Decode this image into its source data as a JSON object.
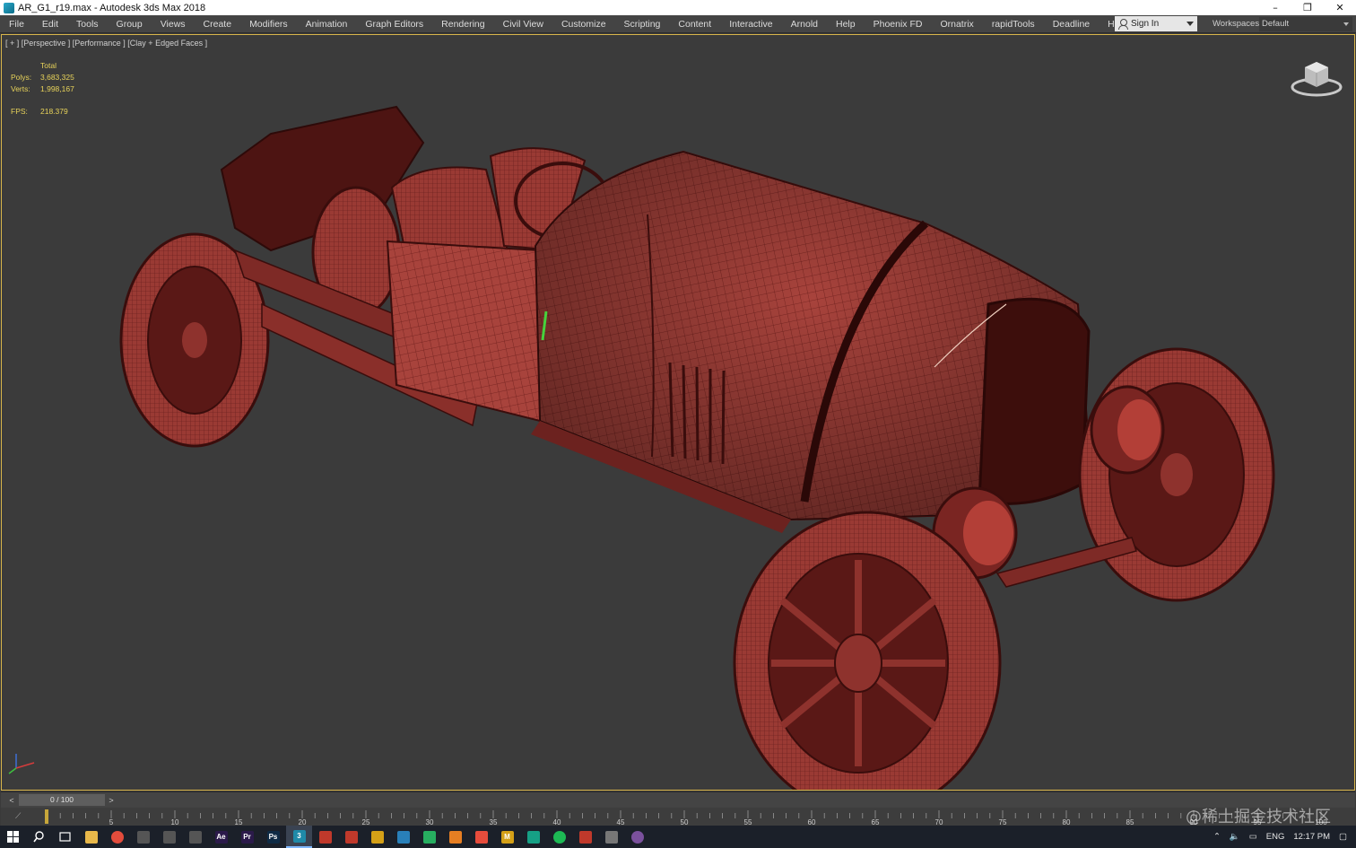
{
  "window": {
    "title": "AR_G1_r19.max - Autodesk 3ds Max 2018",
    "controls": [
      "–",
      "❐",
      "✕"
    ]
  },
  "menu": [
    "File",
    "Edit",
    "Tools",
    "Group",
    "Views",
    "Create",
    "Modifiers",
    "Animation",
    "Graph Editors",
    "Rendering",
    "Civil View",
    "Customize",
    "Scripting",
    "Content",
    "Interactive",
    "Arnold",
    "Help",
    "Phoenix FD",
    "Ornatrix",
    "rapidTools",
    "Deadline",
    "Houdini Engine"
  ],
  "signin": {
    "label": "Sign In"
  },
  "workspace": {
    "label": "Workspaces:",
    "value": "Default"
  },
  "viewport": {
    "label": "[ + ] [Perspective ] [Performance ] [Clay + Edged Faces ]",
    "stats": {
      "header": "Total",
      "polys_label": "Polys:",
      "polys": "3,683,325",
      "verts_label": "Verts:",
      "verts": "1,998,167",
      "fps_label": "FPS:",
      "fps": "218.379"
    },
    "model_color": "#a8433c",
    "bg_color": "#3b3b3b"
  },
  "timeline": {
    "prev": "<",
    "next": ">",
    "frame": "0 / 100",
    "ticks": [
      "5",
      "10",
      "15",
      "20",
      "25",
      "30",
      "35",
      "40",
      "45",
      "50",
      "55",
      "60",
      "65",
      "70",
      "75",
      "80",
      "85",
      "90",
      "95",
      "100"
    ]
  },
  "watermark": "@稀土掘金技术社区",
  "taskbar": {
    "apps": [
      {
        "name": "windows-start-icon",
        "color": "#ffffff",
        "glyph": ""
      },
      {
        "name": "search-icon",
        "color": "#ffffff",
        "glyph": ""
      },
      {
        "name": "task-view-icon",
        "color": "#ffffff",
        "glyph": ""
      },
      {
        "name": "file-explorer-icon",
        "color": "#e8b84a",
        "glyph": ""
      },
      {
        "name": "chrome-icon",
        "color": "#e34c3c",
        "glyph": ""
      },
      {
        "name": "app-icon-1",
        "color": "#555555",
        "glyph": ""
      },
      {
        "name": "app-icon-2",
        "color": "#555555",
        "glyph": ""
      },
      {
        "name": "app-icon-3",
        "color": "#555555",
        "glyph": ""
      },
      {
        "name": "after-effects-icon",
        "color": "#2b1a4a",
        "glyph": "Ae"
      },
      {
        "name": "premiere-icon",
        "color": "#2b1a4a",
        "glyph": "Pr"
      },
      {
        "name": "photoshop-icon",
        "color": "#0f2b45",
        "glyph": "Ps"
      },
      {
        "name": "3ds-max-icon",
        "color": "#1f8aa8",
        "glyph": "3"
      },
      {
        "name": "app-icon-4",
        "color": "#c0392b",
        "glyph": ""
      },
      {
        "name": "app-icon-5",
        "color": "#c0392b",
        "glyph": ""
      },
      {
        "name": "app-icon-6",
        "color": "#d4a017",
        "glyph": ""
      },
      {
        "name": "app-icon-7",
        "color": "#2980b9",
        "glyph": ""
      },
      {
        "name": "app-icon-8",
        "color": "#27ae60",
        "glyph": ""
      },
      {
        "name": "houdini-icon",
        "color": "#e67e22",
        "glyph": ""
      },
      {
        "name": "app-icon-9",
        "color": "#e74c3c",
        "glyph": ""
      },
      {
        "name": "mari-icon",
        "color": "#d4a017",
        "glyph": "M"
      },
      {
        "name": "app-icon-10",
        "color": "#16a085",
        "glyph": ""
      },
      {
        "name": "spotify-icon",
        "color": "#1db954",
        "glyph": ""
      },
      {
        "name": "app-icon-11",
        "color": "#c0392b",
        "glyph": ""
      },
      {
        "name": "app-icon-12",
        "color": "#777777",
        "glyph": ""
      },
      {
        "name": "viber-icon",
        "color": "#7b519d",
        "glyph": ""
      }
    ],
    "lang": "ENG",
    "time": "12:17 PM"
  }
}
